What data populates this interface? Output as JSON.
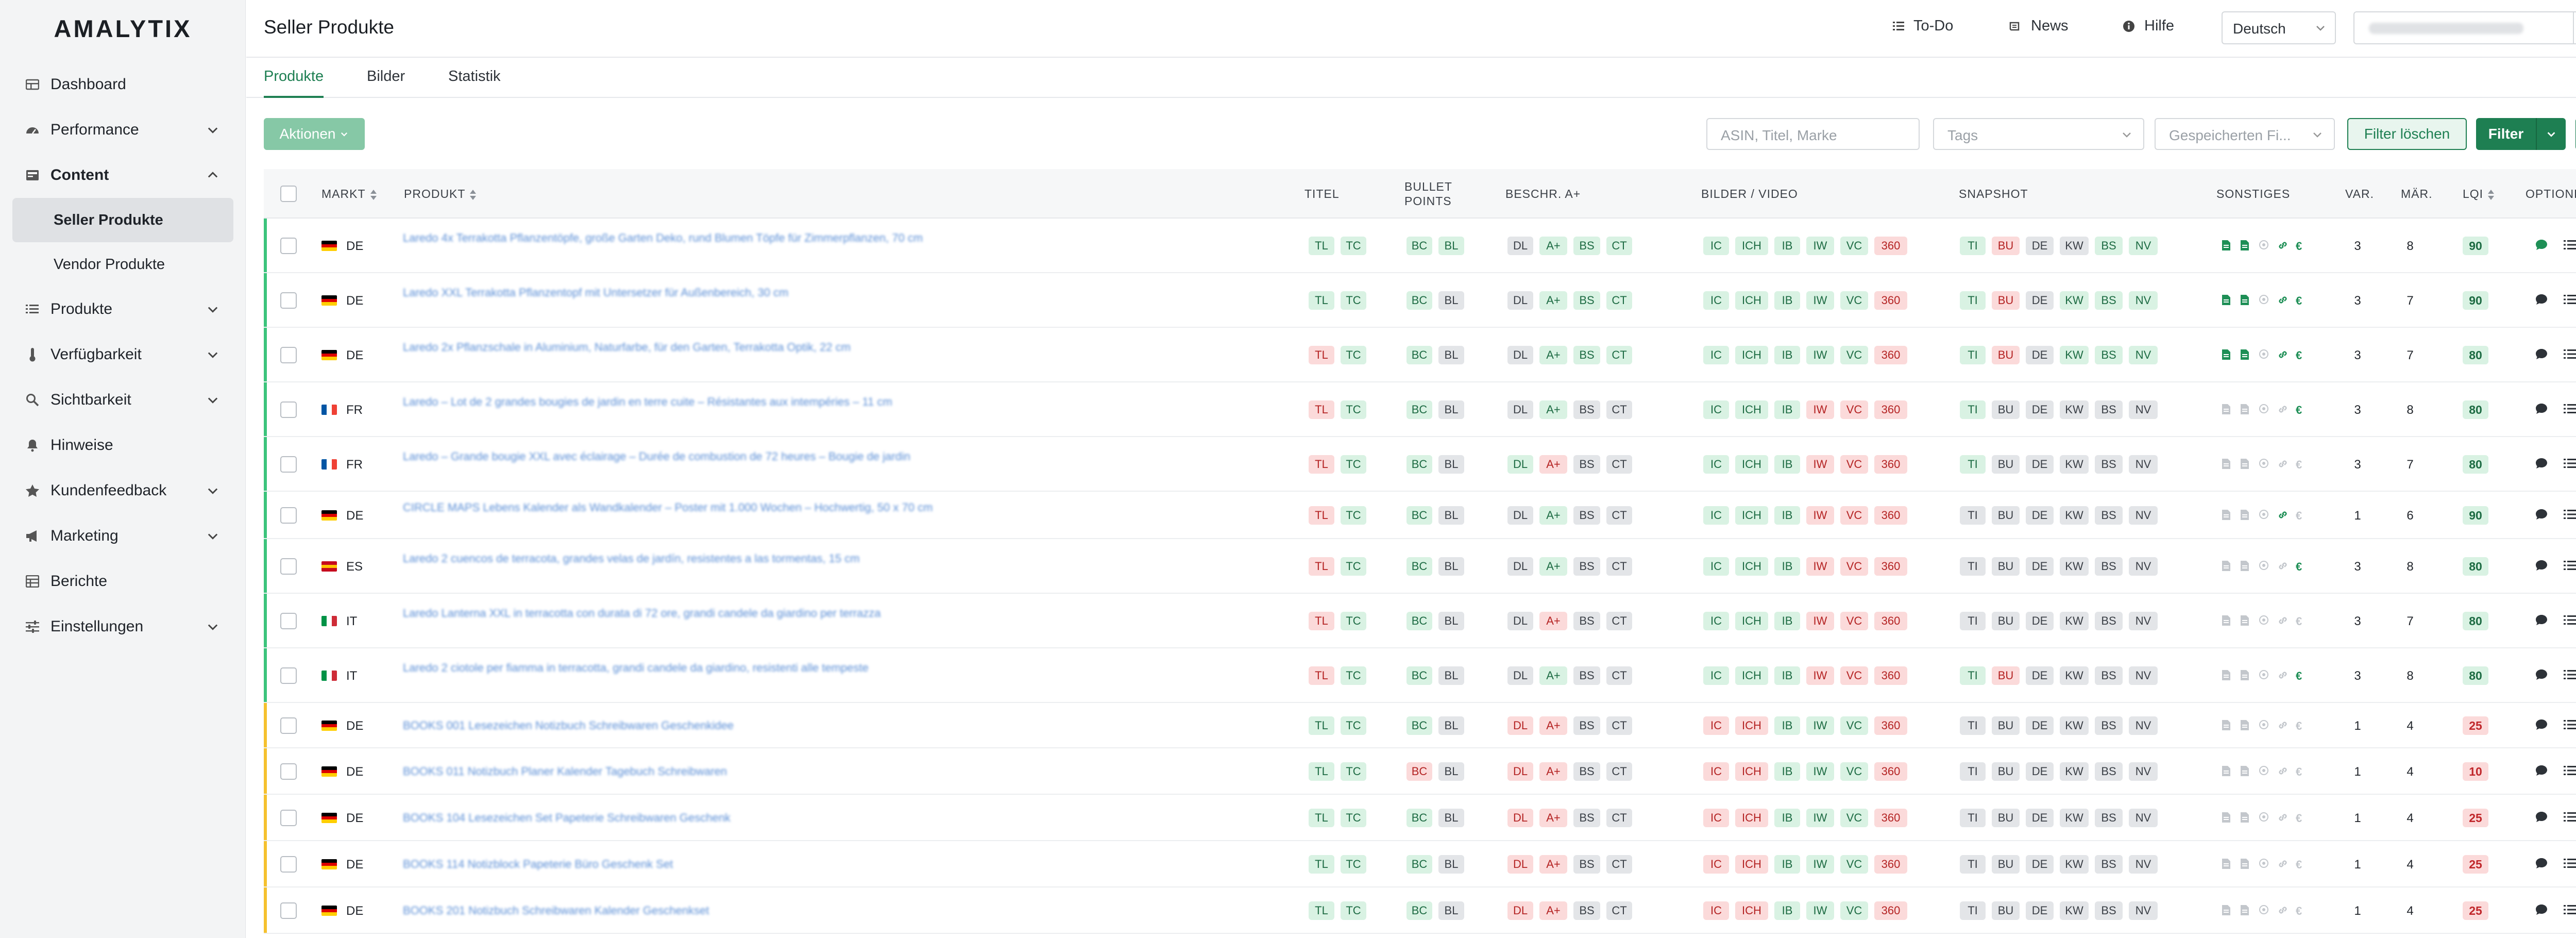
{
  "brand": {
    "logo": "AMALYTIX",
    "accent": "#1e7f52",
    "ok": "#d9f2e3",
    "bad": "#fbdada"
  },
  "sidebar": {
    "items": [
      {
        "label": "Dashboard",
        "icon": "dashboard-icon",
        "chevron": false
      },
      {
        "label": "Performance",
        "icon": "gauge-icon",
        "chevron": true
      },
      {
        "label": "Content",
        "icon": "content-icon",
        "chevron": true,
        "expanded": true
      },
      {
        "label": "Seller Produkte",
        "sub": true,
        "active": true
      },
      {
        "label": "Vendor Produkte",
        "sub": true
      },
      {
        "label": "Produkte",
        "icon": "list-icon",
        "chevron": true
      },
      {
        "label": "Verfügbarkeit",
        "icon": "thermometer-icon",
        "chevron": true
      },
      {
        "label": "Sichtbarkeit",
        "icon": "search-icon",
        "chevron": true
      },
      {
        "label": "Hinweise",
        "icon": "bell-icon",
        "chevron": false
      },
      {
        "label": "Kundenfeedback",
        "icon": "star-icon",
        "chevron": true
      },
      {
        "label": "Marketing",
        "icon": "megaphone-icon",
        "chevron": true
      },
      {
        "label": "Berichte",
        "icon": "table-icon",
        "chevron": false
      },
      {
        "label": "Einstellungen",
        "icon": "sliders-icon",
        "chevron": true
      }
    ]
  },
  "header": {
    "title": "Seller Produkte",
    "todo": "To-Do",
    "news": "News",
    "help": "Hilfe",
    "language": "Deutsch"
  },
  "tabs": [
    "Produkte",
    "Bilder",
    "Statistik"
  ],
  "toolbar": {
    "actions": "Aktionen",
    "search_placeholder": "ASIN, Titel, Marke",
    "tags_placeholder": "Tags",
    "saved_placeholder": "Gespeicherten Fi...",
    "clear_filter": "Filter löschen",
    "filter": "Filter"
  },
  "table": {
    "headers": {
      "markt": "MARKT",
      "produkt": "PRODUKT",
      "titel": "TITEL",
      "bullet1": "BULLET",
      "bullet2": "POINTS",
      "beschr": "BESCHR. A+",
      "bilder": "BILDER / VIDEO",
      "snapshot": "SNAPSHOT",
      "sonstiges": "SONSTIGES",
      "var": "VAR.",
      "maer": "MÄR.",
      "lqi": "LQI",
      "optionen": "OPTIONEN"
    },
    "rows": [
      {
        "status": "green",
        "market": "DE",
        "flag": "de",
        "product": "Laredo 4x Terrakotta Pflanzentöpfe, große Garten Deko, rund Blumen Töpfe für Zimmerpflanzen, 70 cm",
        "titel": "gg",
        "bullet": "gg",
        "beschr": "xggg",
        "bilder": "gggggr",
        "snap": "grxxgg",
        "sonst": "active",
        "var": 3,
        "maer": 8,
        "lqi": 90,
        "comment": "green"
      },
      {
        "status": "green",
        "market": "DE",
        "flag": "de",
        "product": "Laredo XXL Terrakotta Pflanzentopf mit Untersetzer für Außenbereich, 30 cm",
        "titel": "gg",
        "bullet": "gx",
        "beschr": "xggg",
        "bilder": "gggggr",
        "snap": "grxggg",
        "sonst": "active",
        "var": 3,
        "maer": 7,
        "lqi": 90,
        "comment": "dark"
      },
      {
        "status": "green",
        "market": "DE",
        "flag": "de",
        "product": "Laredo 2x Pflanzschale in Aluminium, Naturfarbe, für den Garten, Terrakotta Optik, 22 cm",
        "titel": "rg",
        "bullet": "gx",
        "beschr": "xggg",
        "bilder": "gggggr",
        "snap": "grxggg",
        "sonst": "active",
        "var": 3,
        "maer": 7,
        "lqi": 80,
        "comment": "dark"
      },
      {
        "status": "green",
        "market": "FR",
        "flag": "fr",
        "product": "Laredo – Lot de 2 grandes bougies de jardin en terre cuite – Résistantes aux intempéries – 11 cm",
        "titel": "rg",
        "bullet": "gx",
        "beschr": "xgxx",
        "bilder": "gggrrr",
        "snap": "gxxxxx",
        "sonst": "euro",
        "var": 3,
        "maer": 8,
        "lqi": 80,
        "comment": "dark"
      },
      {
        "status": "green",
        "market": "FR",
        "flag": "fr",
        "product": "Laredo – Grande bougie XXL avec éclairage – Durée de combustion de 72 heures – Bougie de jardin",
        "titel": "rg",
        "bullet": "gx",
        "beschr": "grxx",
        "bilder": "gggrrr",
        "snap": "gxxxxx",
        "sonst": "none",
        "var": 3,
        "maer": 7,
        "lqi": 80,
        "comment": "dark"
      },
      {
        "status": "green",
        "market": "DE",
        "flag": "de",
        "product": "CIRCLE MAPS Lebens Kalender als Wandkalender – Poster mit 1.000 Wochen – Hochwertig, 50 x 70 cm",
        "titel": "rg",
        "bullet": "gx",
        "beschr": "xgxx",
        "bilder": "gggrrr",
        "snap": "xxxxxx",
        "sonst": "link",
        "var": 1,
        "maer": 6,
        "lqi": 90,
        "comment": "dark"
      },
      {
        "status": "green",
        "market": "ES",
        "flag": "es",
        "product": "Laredo 2 cuencos de terracota, grandes velas de jardín, resistentes a las tormentas, 15 cm",
        "titel": "rg",
        "bullet": "gx",
        "beschr": "xgxx",
        "bilder": "gggrrr",
        "snap": "xxxxxx",
        "sonst": "euro",
        "var": 3,
        "maer": 8,
        "lqi": 80,
        "comment": "dark"
      },
      {
        "status": "green",
        "market": "IT",
        "flag": "it",
        "product": "Laredo Lanterna XXL in terracotta con durata di 72 ore, grandi candele da giardino per terrazza",
        "titel": "rg",
        "bullet": "gx",
        "beschr": "xrxx",
        "bilder": "gggrrr",
        "snap": "xxxxxx",
        "sonst": "none",
        "var": 3,
        "maer": 7,
        "lqi": 80,
        "comment": "dark"
      },
      {
        "status": "green",
        "market": "IT",
        "flag": "it",
        "product": "Laredo 2 ciotole per fiamma in terracotta, grandi candele da giardino, resistenti alle tempeste",
        "titel": "rg",
        "bullet": "gx",
        "beschr": "xgxx",
        "bilder": "gggrrr",
        "snap": "grxxxx",
        "sonst": "euro",
        "var": 3,
        "maer": 8,
        "lqi": 80,
        "comment": "dark"
      },
      {
        "status": "yellow",
        "market": "DE",
        "flag": "de",
        "product": "BOOKS 001 Lesezeichen Notizbuch Schreibwaren Geschenkidee",
        "titel": "gg",
        "bullet": "gx",
        "beschr": "rrxx",
        "bilder": "rrgggr",
        "snap": "xxxxxx",
        "sonst": "none",
        "var": 1,
        "maer": 4,
        "lqi": 25,
        "comment": "dark"
      },
      {
        "status": "yellow",
        "market": "DE",
        "flag": "de",
        "product": "BOOKS 011 Notizbuch Planer Kalender Tagebuch Schreibwaren",
        "titel": "gg",
        "bullet": "rx",
        "beschr": "rrxx",
        "bilder": "rrgggr",
        "snap": "xxxxxx",
        "sonst": "none",
        "var": 1,
        "maer": 4,
        "lqi": 10,
        "comment": "dark"
      },
      {
        "status": "yellow",
        "market": "DE",
        "flag": "de",
        "product": "BOOKS 104 Lesezeichen Set Papeterie Schreibwaren Geschenk",
        "titel": "gg",
        "bullet": "gx",
        "beschr": "rrxx",
        "bilder": "rrgggr",
        "snap": "xxxxxx",
        "sonst": "none",
        "var": 1,
        "maer": 4,
        "lqi": 25,
        "comment": "dark"
      },
      {
        "status": "yellow",
        "market": "DE",
        "flag": "de",
        "product": "BOOKS 114 Notizblock Papeterie Büro Geschenk Set",
        "titel": "gg",
        "bullet": "gx",
        "beschr": "rrxx",
        "bilder": "rrgggr",
        "snap": "xxxxxx",
        "sonst": "none",
        "var": 1,
        "maer": 4,
        "lqi": 25,
        "comment": "dark"
      },
      {
        "status": "yellow",
        "market": "DE",
        "flag": "de",
        "product": "BOOKS 201 Notizbuch Schreibwaren Kalender Geschenkset",
        "titel": "gg",
        "bullet": "gx",
        "beschr": "rrxx",
        "bilder": "rrgggr",
        "snap": "xxxxxx",
        "sonst": "none",
        "var": 1,
        "maer": 4,
        "lqi": 25,
        "comment": "dark"
      }
    ]
  },
  "badge_labels": {
    "titel": [
      "TL",
      "TC"
    ],
    "bullet": [
      "BC",
      "BL"
    ],
    "beschr": [
      "DL",
      "A+",
      "BS",
      "CT"
    ],
    "bilder": [
      "IC",
      "ICH",
      "IB",
      "IW",
      "VC",
      "360"
    ],
    "snap": [
      "TI",
      "BU",
      "DE",
      "KW",
      "BS",
      "NV"
    ]
  }
}
